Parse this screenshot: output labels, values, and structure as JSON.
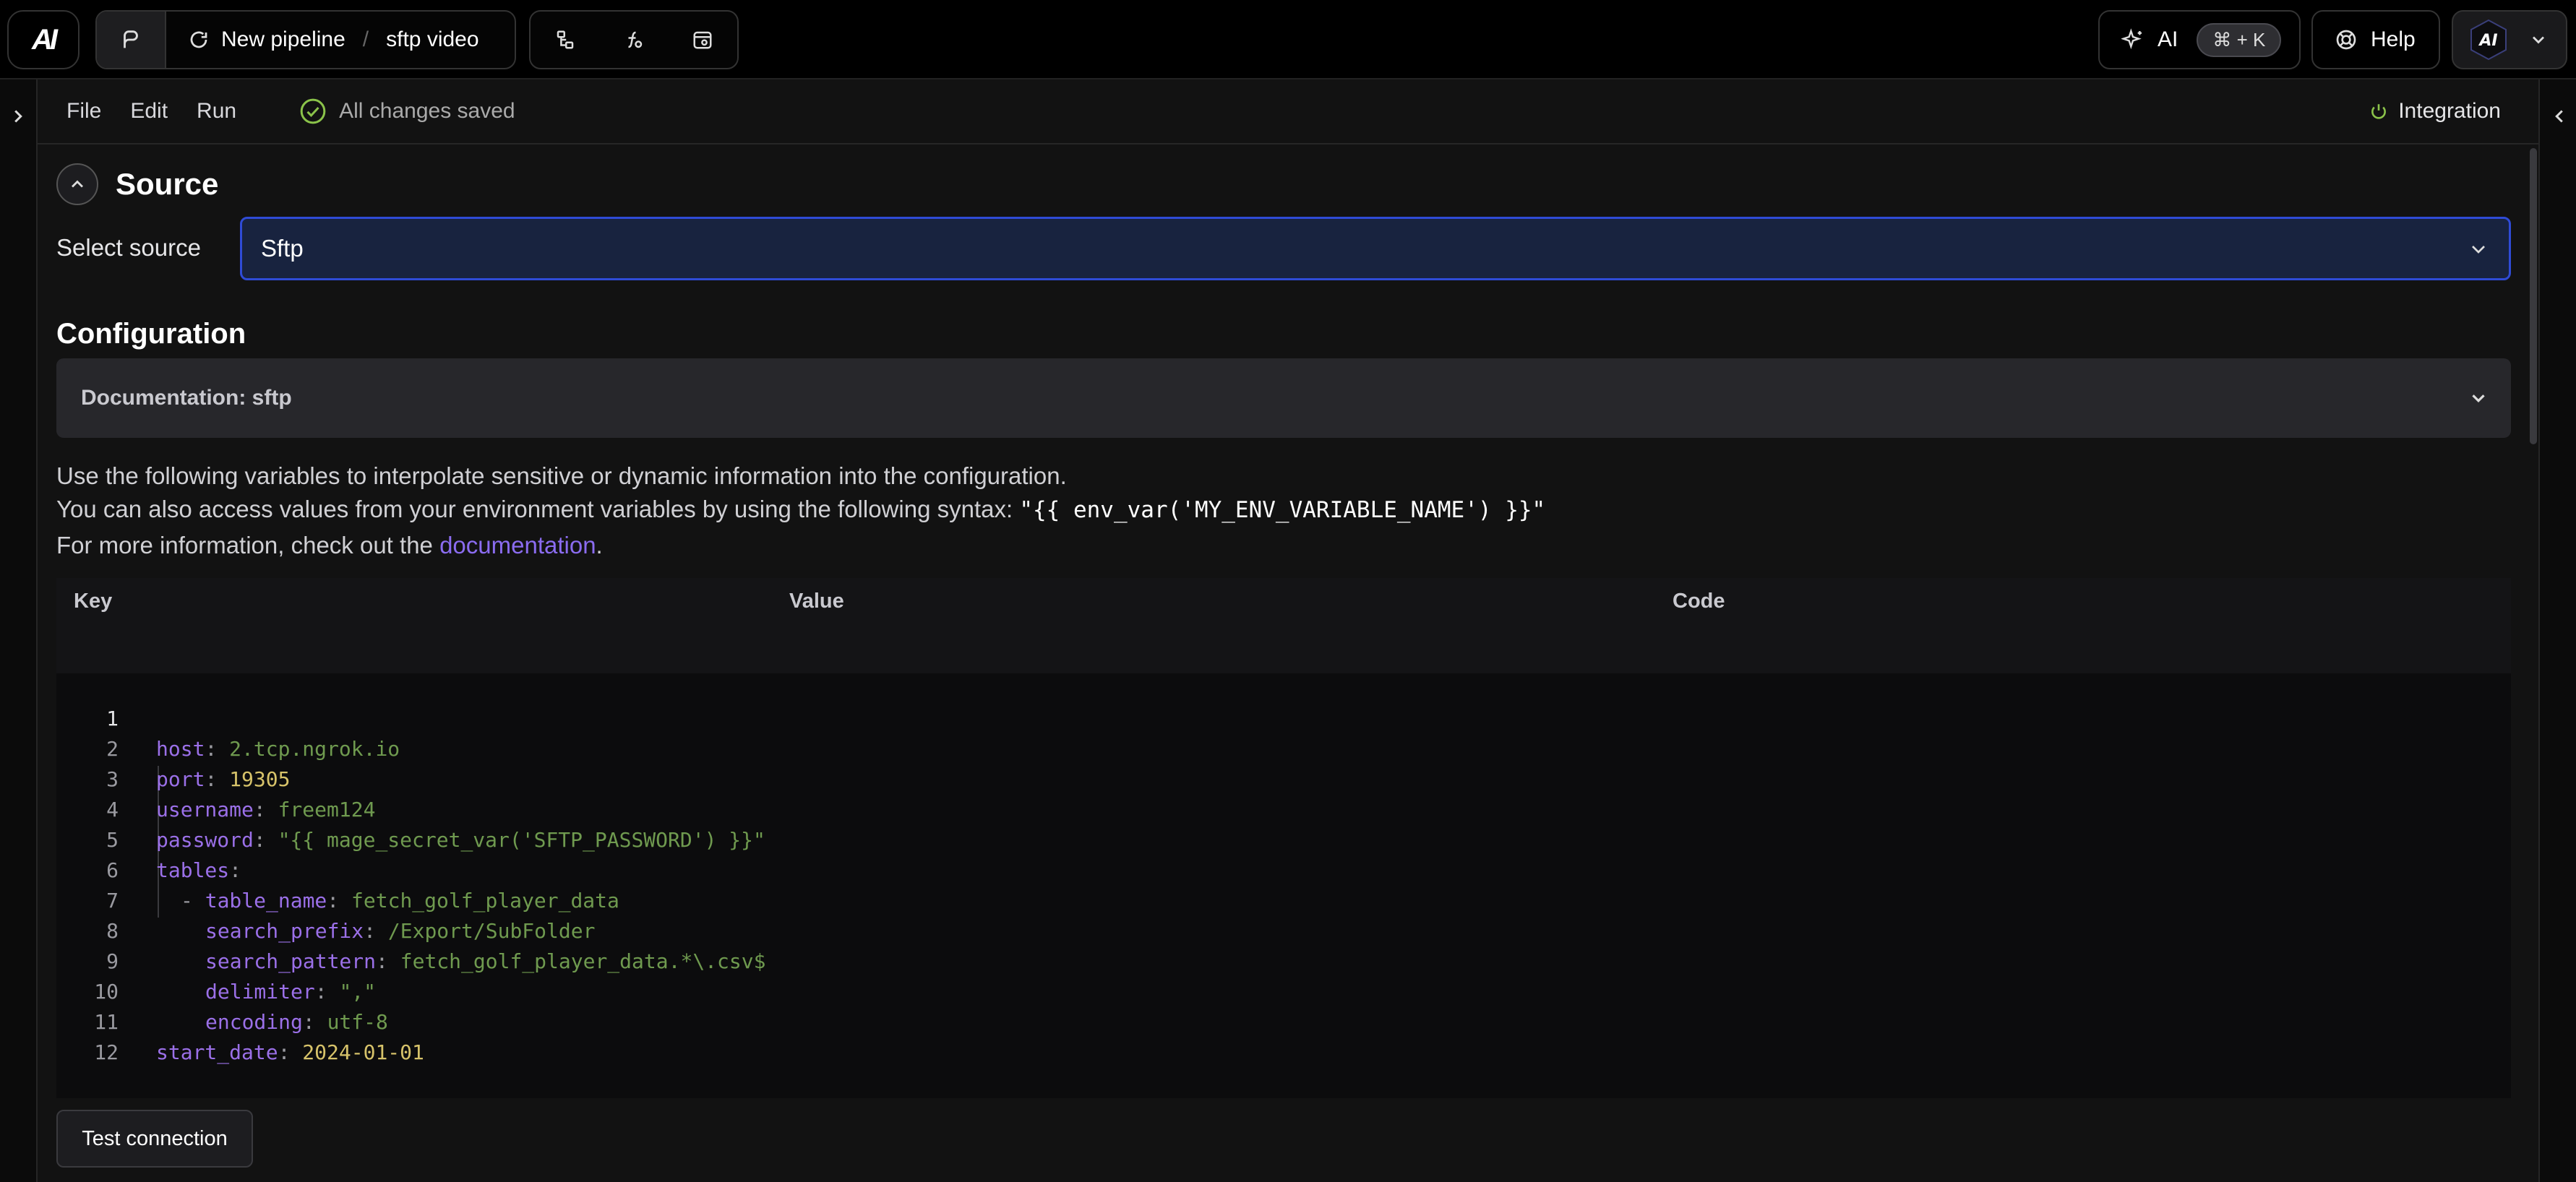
{
  "topbar": {
    "logo": "AI",
    "pipeline_label": "New pipeline",
    "breadcrumb_sep": "/",
    "pipeline_name": "sftp video",
    "ai_label": "AI",
    "ai_shortcut": "⌘ + K",
    "help_label": "Help",
    "avatar": "AI"
  },
  "menubar": {
    "file": "File",
    "edit": "Edit",
    "run": "Run",
    "saved_status": "All changes saved",
    "integration": "Integration"
  },
  "source": {
    "title": "Source",
    "select_label": "Select source",
    "selected": "Sftp"
  },
  "configuration": {
    "title": "Configuration",
    "doc_title": "Documentation: sftp",
    "info_line1": "Use the following variables to interpolate sensitive or dynamic information into the configuration.",
    "info_line2": "You can also access values from your environment variables by using the following syntax: ",
    "info_syntax": "\"{{ env_var('MY_ENV_VARIABLE_NAME') }}\"",
    "info_line3_prefix": "For more information, check out the ",
    "info_link": "documentation",
    "info_line3_suffix": "."
  },
  "vars_table": {
    "columns": [
      "Key",
      "Value",
      "Code"
    ]
  },
  "code": {
    "line_numbers": [
      "1",
      "2",
      "3",
      "4",
      "5",
      "6",
      "7",
      "8",
      "9",
      "10",
      "11",
      "12"
    ],
    "l1": {
      "key": "host",
      "val": "2.tcp.ngrok.io"
    },
    "l2": {
      "key": "port",
      "val": "19305"
    },
    "l3": {
      "key": "username",
      "val": "freem124"
    },
    "l4": {
      "key": "password",
      "val": "\"{{ mage_secret_var('SFTP_PASSWORD') }}\""
    },
    "l5": {
      "key": "tables"
    },
    "l6": {
      "dash": "- ",
      "key": "table_name",
      "val": "fetch_golf_player_data"
    },
    "l7": {
      "key": "search_prefix",
      "val": "/Export/SubFolder"
    },
    "l8": {
      "key": "search_pattern",
      "val": "fetch_golf_player_data.*\\.csv$"
    },
    "l9": {
      "key": "delimiter",
      "val": "\",\""
    },
    "l10": {
      "key": "encoding",
      "val": "utf-8"
    },
    "l11": {
      "key": "start_date",
      "val": "2024-01-01"
    }
  },
  "actions": {
    "test_connection": "Test connection"
  },
  "colors": {
    "accent_blue": "#2f4bd6",
    "link_purple": "#8b6cf0",
    "saved_green": "#8bc34a",
    "yaml_key": "#9b70e8",
    "yaml_string": "#6f9a4f",
    "yaml_number": "#d7c36a"
  },
  "icons": {
    "logo": "mage-logo-icon",
    "pipeline": "pipeline-icon",
    "refresh": "refresh-icon",
    "tree": "tree-icon",
    "function": "function-icon",
    "calendar": "calendar-icon",
    "sparkle": "sparkle-icon",
    "help": "help-icon",
    "check": "check-circle-icon",
    "power": "power-icon",
    "chevron": "chevron-down-icon"
  }
}
